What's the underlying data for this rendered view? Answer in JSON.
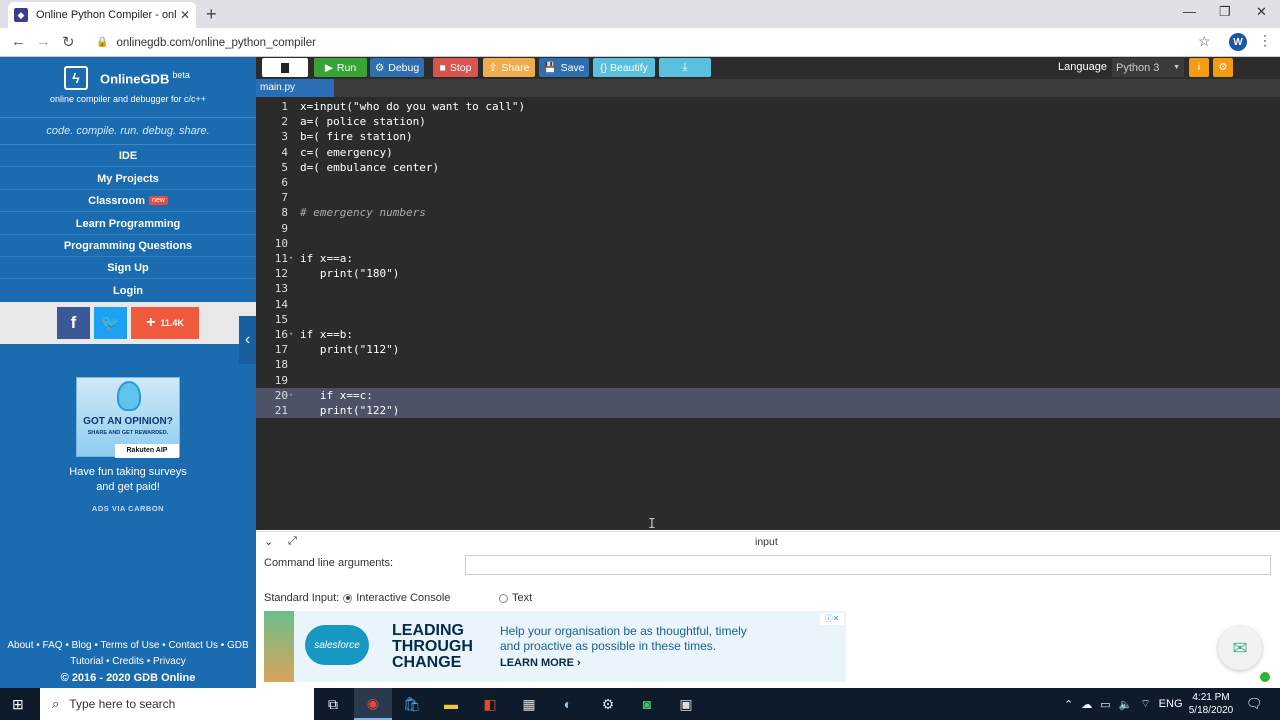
{
  "browser": {
    "tab_title": "Online Python Compiler - online",
    "tab_close": "✕",
    "new_tab": "+",
    "url": "onlinegdb.com/online_python_compiler",
    "avatar_letter": "W",
    "minimize": "—",
    "restore": "❐",
    "close": "✕"
  },
  "sidebar": {
    "brand_name": "OnlineGDB",
    "brand_beta": "beta",
    "brand_sub": "online compiler and debugger for c/c++",
    "tagline": "code. compile. run. debug. share.",
    "nav": [
      {
        "label": "IDE"
      },
      {
        "label": "My Projects"
      },
      {
        "label": "Classroom",
        "badge": "new"
      },
      {
        "label": "Learn Programming"
      },
      {
        "label": "Programming Questions"
      },
      {
        "label": "Sign Up"
      },
      {
        "label": "Login"
      }
    ],
    "share_count": "11.4K",
    "ad": {
      "headline": "GOT AN OPINION?",
      "subline": "SHARE AND GET REWARDED.",
      "brand": "Rakuten AIP",
      "text_line1": "Have fun taking surveys",
      "text_line2": "and get paid!",
      "via": "ADS VIA CARBON"
    },
    "footer_line1": "About • FAQ • Blog • Terms of Use • Contact Us • GDB",
    "footer_line2": "Tutorial • Credits • Privacy",
    "copyright": "© 2016 - 2020 GDB Online"
  },
  "toolbar": {
    "run": "Run",
    "debug": "Debug",
    "stop": "Stop",
    "share": "Share",
    "save": "Save",
    "beautify": "{} Beautify",
    "language_label": "Language",
    "language_value": "Python 3",
    "colors": {
      "run": "#3aa335",
      "debug": "#2e6fb0",
      "stop": "#d9534f",
      "share": "#f0ad4e",
      "save": "#2e6fb0",
      "beautify": "#5bc0de",
      "download": "#5bc0de"
    }
  },
  "editor": {
    "file_tab": "main.py",
    "lines": [
      {
        "n": "1",
        "code": "x=input(\"who do you want to call\")"
      },
      {
        "n": "2",
        "code": "a=( police station)"
      },
      {
        "n": "3",
        "code": "b=( fire station)"
      },
      {
        "n": "4",
        "code": "c=( emergency)"
      },
      {
        "n": "5",
        "code": "d=( embulance center)"
      },
      {
        "n": "6",
        "code": ""
      },
      {
        "n": "7",
        "code": ""
      },
      {
        "n": "8",
        "code": "# emergency numbers"
      },
      {
        "n": "9",
        "code": ""
      },
      {
        "n": "10",
        "code": ""
      },
      {
        "n": "11",
        "code": "if x==a:"
      },
      {
        "n": "12",
        "code": "   print(\"180\")"
      },
      {
        "n": "13",
        "code": ""
      },
      {
        "n": "14",
        "code": ""
      },
      {
        "n": "15",
        "code": ""
      },
      {
        "n": "16",
        "code": "if x==b:"
      },
      {
        "n": "17",
        "code": "   print(\"112\")"
      },
      {
        "n": "18",
        "code": ""
      },
      {
        "n": "19",
        "code": ""
      },
      {
        "n": "20",
        "code": "   if x==c:"
      },
      {
        "n": "21",
        "code": "   print(\"122\")"
      }
    ]
  },
  "io": {
    "panel_label": "input",
    "cmd_label": "Command line arguments:",
    "cmd_value": "",
    "stdin_label": "Standard Input:",
    "opt_console": "Interactive Console",
    "opt_text": "Text"
  },
  "sf_ad": {
    "brand": "salesforce",
    "head1": "LEADING",
    "head2": "THROUGH",
    "head3": "CHANGE",
    "body1": "Help your organisation be as thoughtful, timely",
    "body2": "and proactive as possible in these times.",
    "more": "LEARN MORE ›",
    "adx": "ⓘ✕"
  },
  "taskbar": {
    "search_placeholder": "Type here to search",
    "lang": "ENG",
    "time": "4:21 PM",
    "date": "5/18/2020"
  }
}
